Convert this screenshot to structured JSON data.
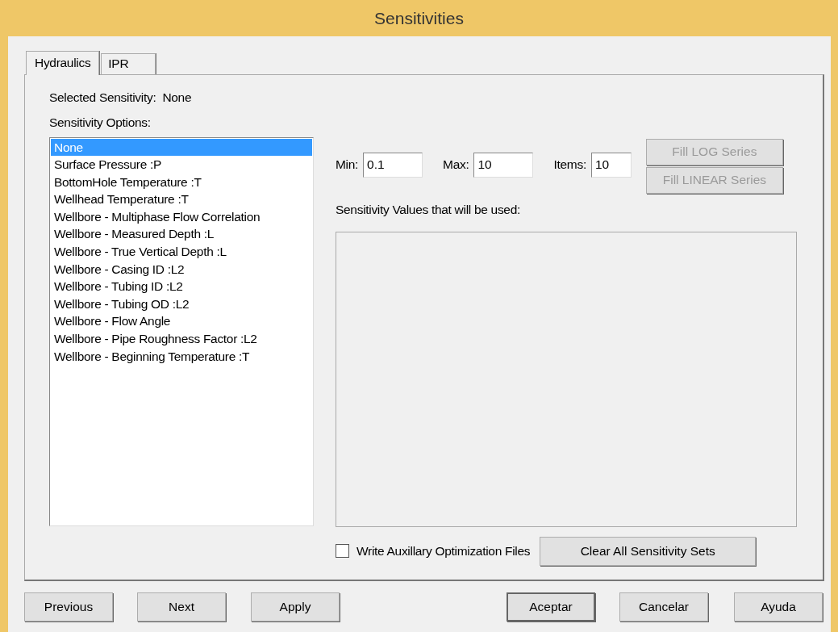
{
  "window": {
    "title": "Sensitivities"
  },
  "tabs": [
    {
      "label": "Hydraulics",
      "selected": true
    },
    {
      "label": "IPR",
      "selected": false
    }
  ],
  "selected_sensitivity": {
    "label": "Selected Sensitivity:",
    "value": "None"
  },
  "options_label": "Sensitivity Options:",
  "options": [
    {
      "label": "None",
      "selected": true
    },
    {
      "label": "Surface Pressure :P",
      "selected": false
    },
    {
      "label": "BottomHole Temperature :T",
      "selected": false
    },
    {
      "label": "Wellhead Temperature :T",
      "selected": false
    },
    {
      "label": "Wellbore - Multiphase Flow Correlation",
      "selected": false
    },
    {
      "label": "Wellbore - Measured Depth :L",
      "selected": false
    },
    {
      "label": "Wellbore - True Vertical Depth :L",
      "selected": false
    },
    {
      "label": "Wellbore - Casing ID :L2",
      "selected": false
    },
    {
      "label": "Wellbore - Tubing ID :L2",
      "selected": false
    },
    {
      "label": "Wellbore - Tubing OD :L2",
      "selected": false
    },
    {
      "label": "Wellbore - Flow Angle",
      "selected": false
    },
    {
      "label": "Wellbore - Pipe Roughness Factor :L2",
      "selected": false
    },
    {
      "label": "Wellbore - Beginning Temperature :T",
      "selected": false
    }
  ],
  "fields": [
    {
      "label": "Min:",
      "value": "0.1"
    },
    {
      "label": "Max:",
      "value": "10"
    },
    {
      "label": "Items:",
      "value": "10"
    }
  ],
  "fill_buttons": [
    {
      "label": "Fill LOG Series",
      "disabled": true
    },
    {
      "label": "Fill LINEAR Series",
      "disabled": true
    }
  ],
  "values_label": "Sensitivity Values that will be used:",
  "write_files": {
    "label": "Write Auxillary Optimization Files",
    "checked": false
  },
  "clear_button": "Clear All Sensitivity Sets",
  "footer_buttons": [
    {
      "label": "Previous",
      "default": false
    },
    {
      "label": "Next",
      "default": false
    },
    {
      "label": "Apply",
      "default": false
    },
    {
      "label": "Aceptar",
      "default": true
    },
    {
      "label": "Cancelar",
      "default": false
    },
    {
      "label": "Ayuda",
      "default": false
    }
  ]
}
